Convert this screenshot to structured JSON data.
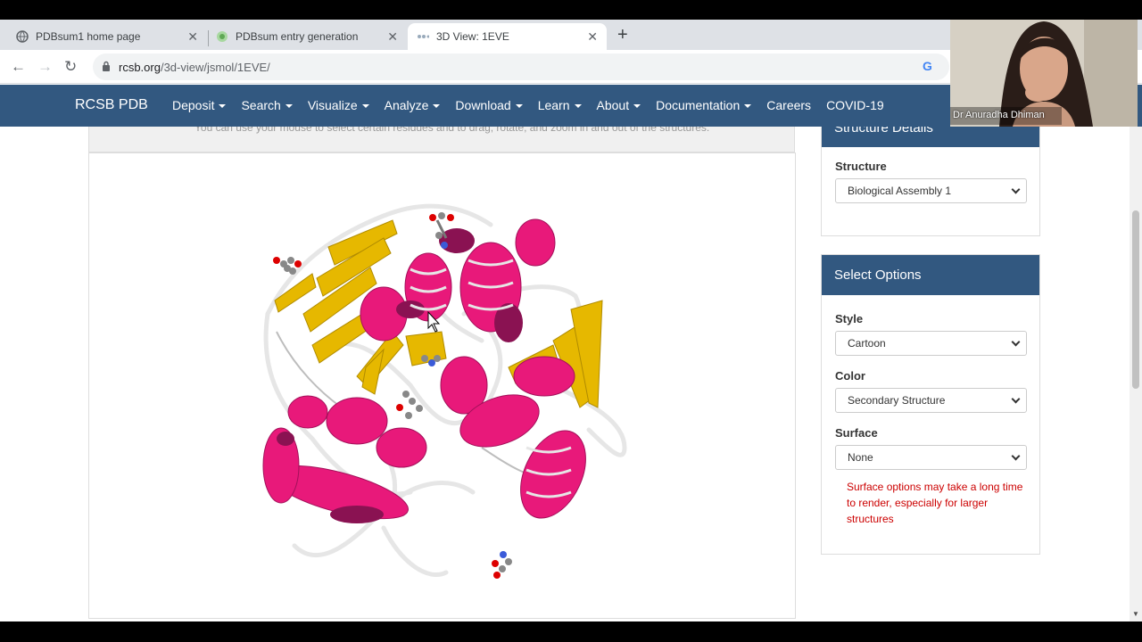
{
  "browser": {
    "tabs": [
      {
        "title": "PDBsum1 home page",
        "active": false
      },
      {
        "title": "PDBsum entry generation",
        "active": false
      },
      {
        "title": "3D View: 1EVE",
        "active": true
      }
    ],
    "url_host": "rcsb.org",
    "url_path": "/3d-view/jsmol/1EVE/"
  },
  "navbar": {
    "brand": "RCSB PDB",
    "items": [
      {
        "label": "Deposit",
        "dropdown": true
      },
      {
        "label": "Search",
        "dropdown": true
      },
      {
        "label": "Visualize",
        "dropdown": true
      },
      {
        "label": "Analyze",
        "dropdown": true
      },
      {
        "label": "Download",
        "dropdown": true
      },
      {
        "label": "Learn",
        "dropdown": true
      },
      {
        "label": "About",
        "dropdown": true
      },
      {
        "label": "Documentation",
        "dropdown": true
      },
      {
        "label": "Careers",
        "dropdown": false
      },
      {
        "label": "COVID-19",
        "dropdown": false
      }
    ]
  },
  "viewer": {
    "hint": "You can use your mouse to select certain residues and to drag, rotate, and zoom in and out of the structures."
  },
  "structure_panel": {
    "title": "Structure Details",
    "structure_label": "Structure",
    "structure_value": "Biological Assembly 1"
  },
  "options_panel": {
    "title": "Select Options",
    "style_label": "Style",
    "style_value": "Cartoon",
    "color_label": "Color",
    "color_value": "Secondary Structure",
    "surface_label": "Surface",
    "surface_value": "None",
    "warning": "Surface options may take a long time to render, especially for larger structures"
  },
  "webcam": {
    "name": "Dr Anuradha Dhiman"
  },
  "colors": {
    "navbar": "#325880",
    "helix": "#e8197a",
    "helix_dark": "#8a1252",
    "sheet": "#e6b800",
    "coil": "#e8e8e8",
    "warning": "#cc0000"
  }
}
